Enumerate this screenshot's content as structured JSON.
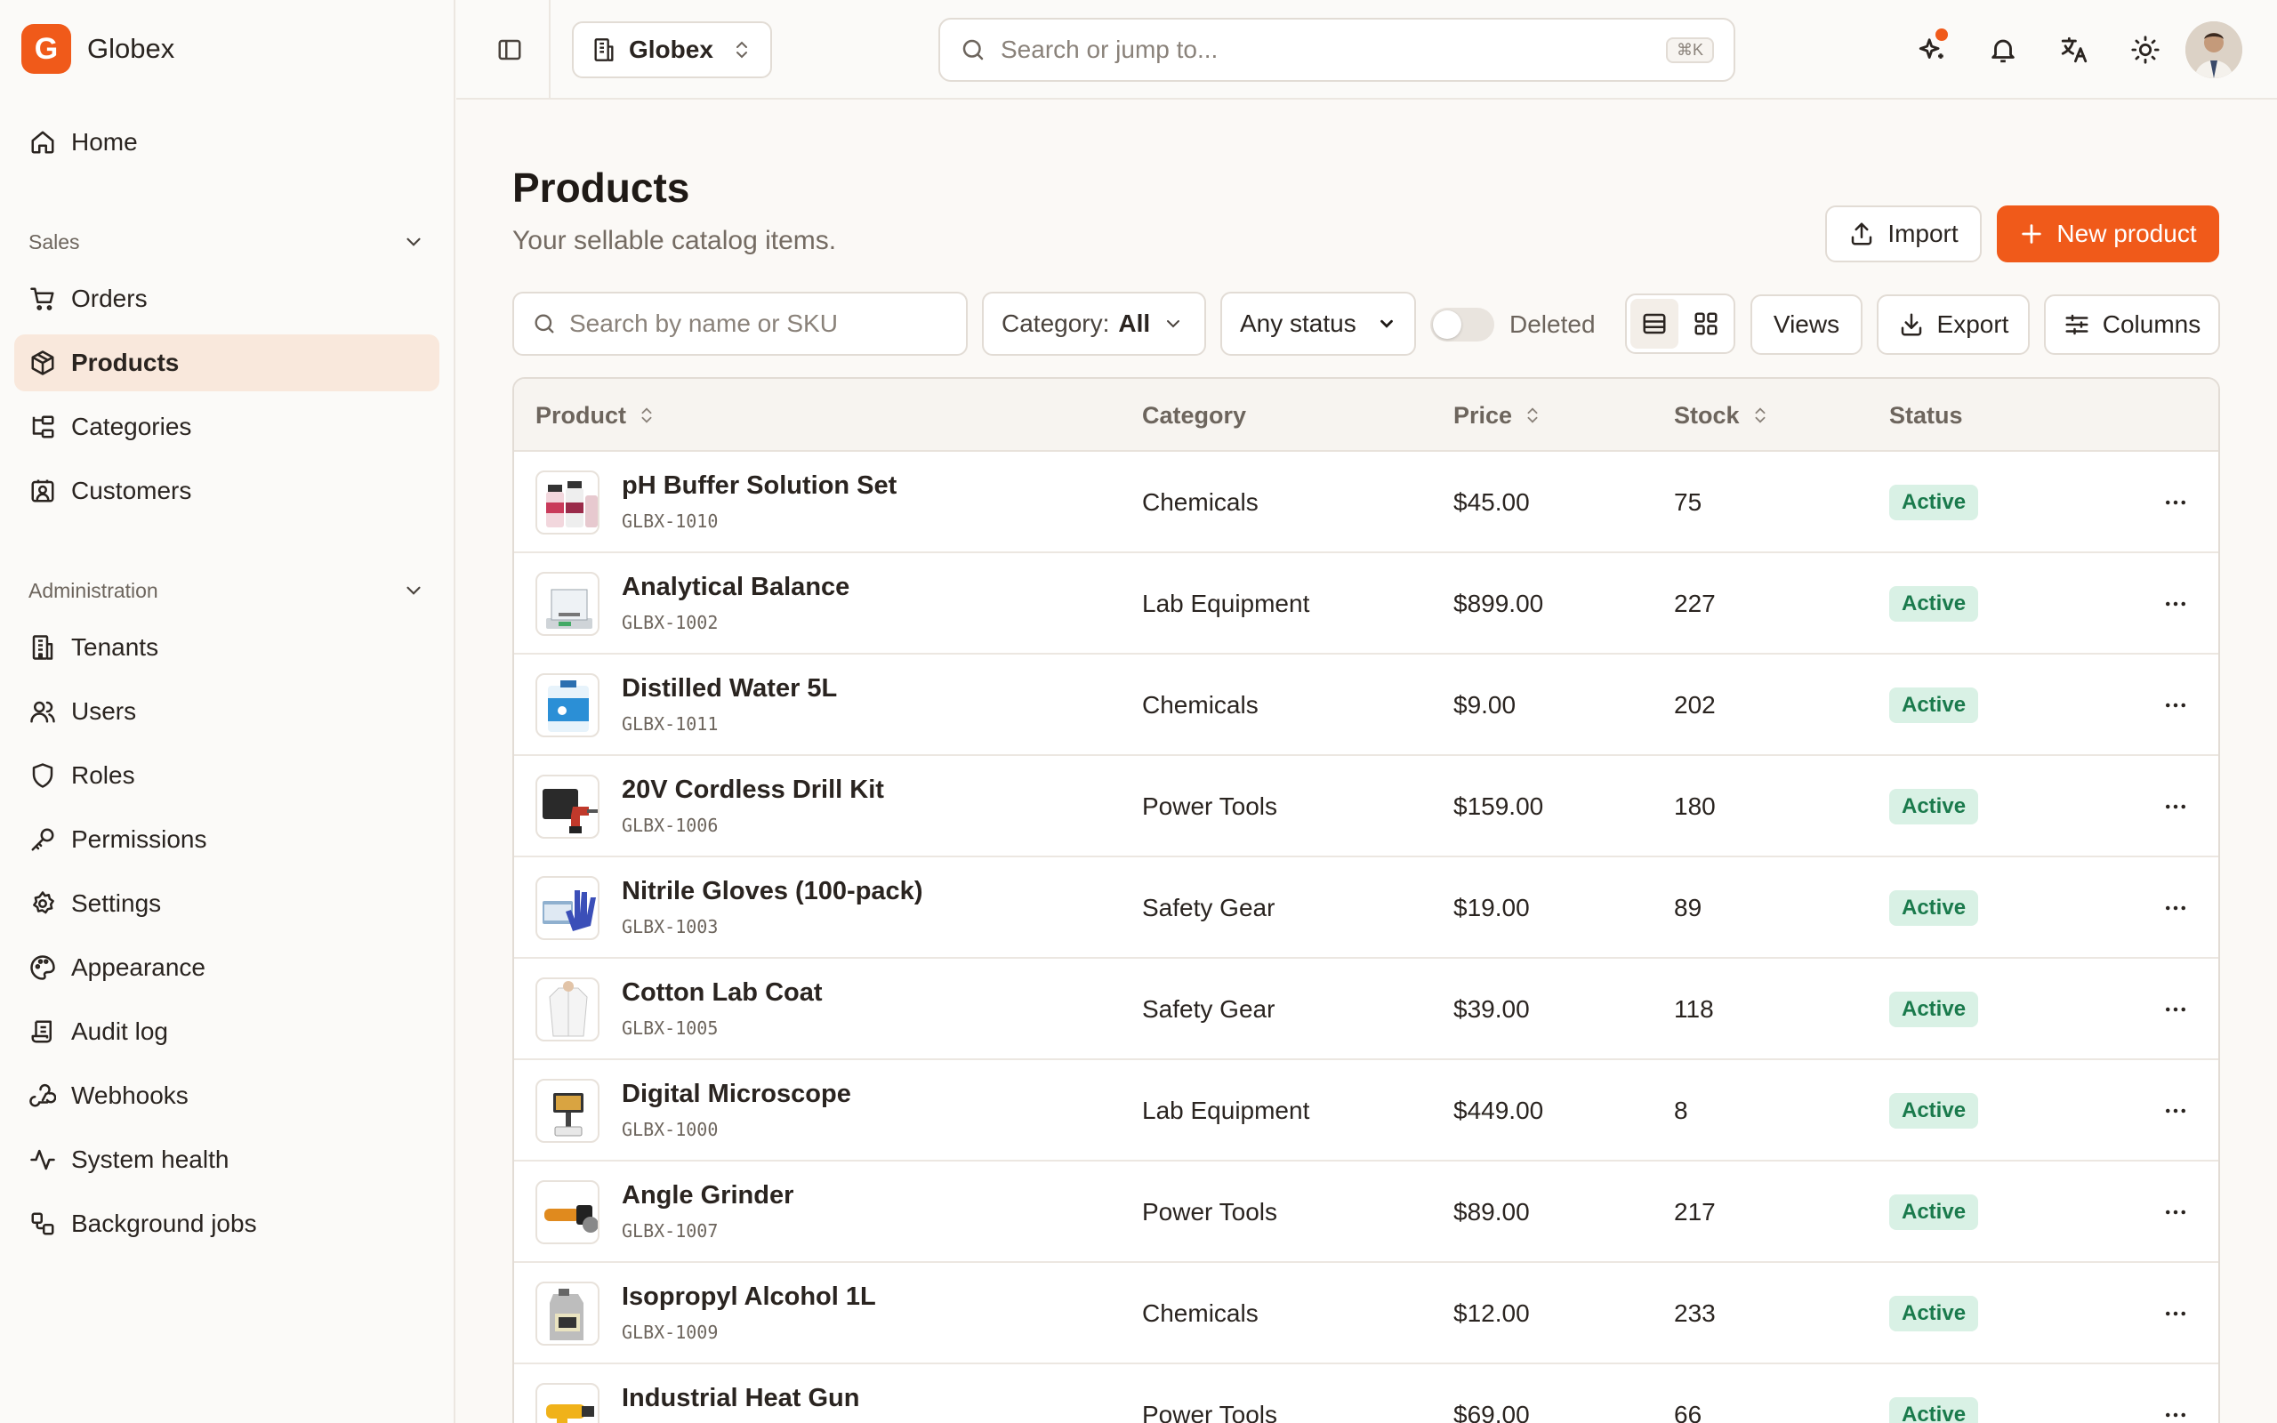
{
  "app": {
    "brand_initial": "G",
    "brand_name": "Globex",
    "accent_color": "#f05a1a"
  },
  "sidebar": {
    "home": {
      "label": "Home",
      "icon": "home-icon"
    },
    "sections": [
      {
        "title": "Sales",
        "items": [
          {
            "label": "Orders",
            "icon": "cart-icon"
          },
          {
            "label": "Products",
            "icon": "package-icon",
            "active": true
          },
          {
            "label": "Categories",
            "icon": "folder-tree-icon"
          },
          {
            "label": "Customers",
            "icon": "contact-icon"
          }
        ]
      },
      {
        "title": "Administration",
        "items": [
          {
            "label": "Tenants",
            "icon": "building-icon"
          },
          {
            "label": "Users",
            "icon": "users-icon"
          },
          {
            "label": "Roles",
            "icon": "shield-icon"
          },
          {
            "label": "Permissions",
            "icon": "key-icon"
          },
          {
            "label": "Settings",
            "icon": "gear-icon"
          },
          {
            "label": "Appearance",
            "icon": "palette-icon"
          },
          {
            "label": "Audit log",
            "icon": "scroll-icon"
          },
          {
            "label": "Webhooks",
            "icon": "webhook-icon"
          },
          {
            "label": "System health",
            "icon": "activity-icon"
          },
          {
            "label": "Background jobs",
            "icon": "workflow-icon"
          }
        ]
      }
    ]
  },
  "topbar": {
    "org": "Globex",
    "search_placeholder": "Search or jump to...",
    "shortcut": "⌘K",
    "icons": [
      "sparkles-icon",
      "bell-icon",
      "translate-icon",
      "sun-icon"
    ]
  },
  "page": {
    "title": "Products",
    "subtitle": "Your sellable catalog items.",
    "import_label": "Import",
    "new_label": "New product"
  },
  "filters": {
    "search_placeholder": "Search by name or SKU",
    "category_label": "Category:",
    "category_value": "All",
    "status_value": "Any status",
    "deleted_label": "Deleted",
    "views_label": "Views",
    "export_label": "Export",
    "columns_label": "Columns"
  },
  "table": {
    "columns": {
      "product": "Product",
      "category": "Category",
      "price": "Price",
      "stock": "Stock",
      "status": "Status"
    },
    "rows": [
      {
        "name": "pH Buffer Solution Set",
        "sku": "GLBX-1010",
        "category": "Chemicals",
        "price": "$45.00",
        "stock": "75",
        "status": "Active",
        "thumb": "bottles"
      },
      {
        "name": "Analytical Balance",
        "sku": "GLBX-1002",
        "category": "Lab Equipment",
        "price": "$899.00",
        "stock": "227",
        "status": "Active",
        "thumb": "balance"
      },
      {
        "name": "Distilled Water 5L",
        "sku": "GLBX-1011",
        "category": "Chemicals",
        "price": "$9.00",
        "stock": "202",
        "status": "Active",
        "thumb": "water"
      },
      {
        "name": "20V Cordless Drill Kit",
        "sku": "GLBX-1006",
        "category": "Power Tools",
        "price": "$159.00",
        "stock": "180",
        "status": "Active",
        "thumb": "drill"
      },
      {
        "name": "Nitrile Gloves (100-pack)",
        "sku": "GLBX-1003",
        "category": "Safety Gear",
        "price": "$19.00",
        "stock": "89",
        "status": "Active",
        "thumb": "gloves"
      },
      {
        "name": "Cotton Lab Coat",
        "sku": "GLBX-1005",
        "category": "Safety Gear",
        "price": "$39.00",
        "stock": "118",
        "status": "Active",
        "thumb": "coat"
      },
      {
        "name": "Digital Microscope",
        "sku": "GLBX-1000",
        "category": "Lab Equipment",
        "price": "$449.00",
        "stock": "8",
        "status": "Active",
        "thumb": "microscope"
      },
      {
        "name": "Angle Grinder",
        "sku": "GLBX-1007",
        "category": "Power Tools",
        "price": "$89.00",
        "stock": "217",
        "status": "Active",
        "thumb": "grinder"
      },
      {
        "name": "Isopropyl Alcohol 1L",
        "sku": "GLBX-1009",
        "category": "Chemicals",
        "price": "$12.00",
        "stock": "233",
        "status": "Active",
        "thumb": "jug"
      },
      {
        "name": "Industrial Heat Gun",
        "sku": "",
        "category": "Power Tools",
        "price": "$69.00",
        "stock": "66",
        "status": "Active",
        "thumb": "heatgun"
      }
    ]
  }
}
